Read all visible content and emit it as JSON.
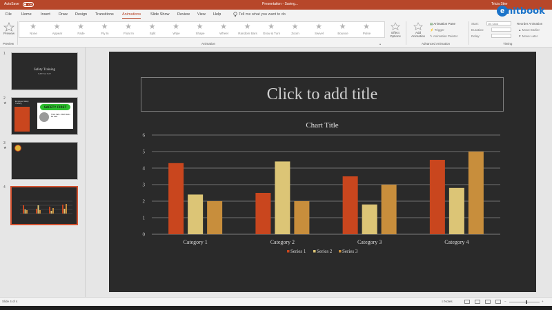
{
  "titlebar": {
    "autosave_label": "AutoSave",
    "autosave_state": "Off",
    "document_title": "Presentation - Saving...",
    "user_name": "Tricia Stier"
  },
  "tabs": [
    "File",
    "Home",
    "Insert",
    "Draw",
    "Design",
    "Transitions",
    "Animations",
    "Slide Show",
    "Review",
    "View",
    "Help"
  ],
  "active_tab": "Animations",
  "tell_me": "Tell me what you want to do",
  "logo_text": "nitbook",
  "ribbon": {
    "preview_label": "Preview",
    "preview_group": "Preview",
    "animation_group": "Animation",
    "animations": [
      "None",
      "Appear",
      "Fade",
      "Fly In",
      "Float In",
      "Split",
      "Wipe",
      "Shape",
      "Wheel",
      "Random Bars",
      "Grow & Turn",
      "Zoom",
      "Swivel",
      "Bounce",
      "Pulse"
    ],
    "effect_options_label": "Effect Options",
    "add_animation_label": "Add Animation",
    "animation_pane_label": "Animation Pane",
    "trigger_label": "Trigger",
    "animation_painter_label": "Animation Painter",
    "advanced_group": "Advanced Animation",
    "start_label": "Start:",
    "start_value": "On Click",
    "duration_label": "Duration:",
    "delay_label": "Delay:",
    "reorder_label": "Reorder Animation",
    "move_earlier_label": "Move Earlier",
    "move_later_label": "Move Later",
    "timing_group": "Timing"
  },
  "slides": [
    {
      "number": "1",
      "title": "Safety Training",
      "subtitle": "SUBTITLE TEXT"
    },
    {
      "number": "2",
      "title": "Employee Safety Training",
      "badge": "SAFETY FIRST",
      "note": "Think Safe - Work Safe - Be Safe"
    },
    {
      "number": "3"
    },
    {
      "number": "4"
    }
  ],
  "slide_title_placeholder": "Click to add title",
  "chart_data": {
    "type": "bar",
    "title": "Chart Title",
    "categories": [
      "Category 1",
      "Category 2",
      "Category 3",
      "Category 4"
    ],
    "series": [
      {
        "name": "Series 1",
        "values": [
          4.3,
          2.5,
          3.5,
          4.5
        ],
        "color": "#c9461e"
      },
      {
        "name": "Series 2",
        "values": [
          2.4,
          4.4,
          1.8,
          2.8
        ],
        "color": "#dcc576"
      },
      {
        "name": "Series 3",
        "values": [
          2.0,
          2.0,
          3.0,
          5.0
        ],
        "color": "#c88e3c"
      }
    ],
    "ylim": [
      0,
      6
    ],
    "yticks": [
      "0",
      "1",
      "2",
      "3",
      "4",
      "5",
      "6"
    ],
    "grid": true,
    "legend_position": "bottom"
  },
  "status": {
    "slide_info": "Slide 4 of 4",
    "notes_label": "Notes"
  }
}
